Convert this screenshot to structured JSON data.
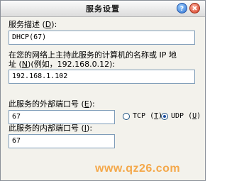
{
  "window": {
    "title": "服务设置"
  },
  "description": {
    "label_pre": "服务描述 (",
    "label_hotkey": "D",
    "label_post": "):",
    "value": "DHCP(67)"
  },
  "host": {
    "label_line1": "在您的网络上主持此服务的计算机的名称或 IP 地",
    "label_line2_pre": "址 (",
    "label_hotkey": "N",
    "label_line2_post": ")(例如，192.168.0.12):",
    "value": "192.168.1.102"
  },
  "external_port": {
    "label_pre": "此服务的外部端口号 (",
    "label_hotkey": "E",
    "label_post": "):",
    "value": "67"
  },
  "internal_port": {
    "label_pre": "此服务的内部端口号 (",
    "label_hotkey": "I",
    "label_post": "):",
    "value": "67"
  },
  "protocol": {
    "tcp_label_pre": "TCP (",
    "tcp_hotkey": "T",
    "tcp_label_post": ")",
    "udp_label_pre": "UDP (",
    "udp_hotkey": "U",
    "udp_label_post": ")",
    "selected": "UDP"
  },
  "watermark": "www.qz26.com"
}
